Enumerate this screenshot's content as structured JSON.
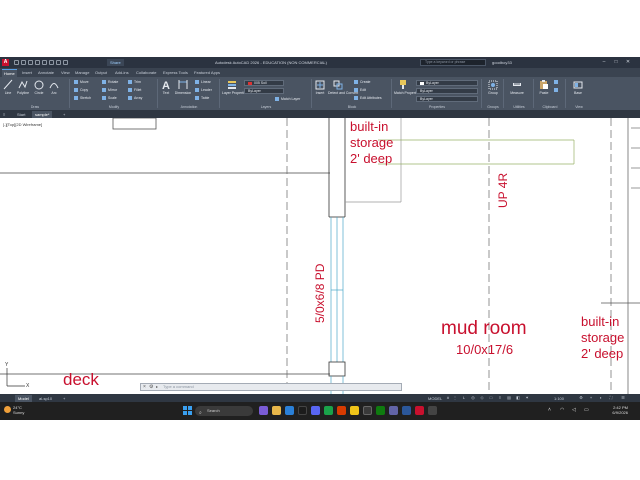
{
  "window": {
    "app_badge": "A",
    "share_label": "Share",
    "title": "Autodesk AutoCAD 2026 - EDUCATION (NON COMMERCIAL)",
    "search_placeholder": "Type a keyword or phrase",
    "user": "goodboy33",
    "min": "–",
    "max": "□",
    "close": "✕"
  },
  "ribbon_tabs": [
    "Home",
    "Insert",
    "Annotate",
    "View",
    "Manage",
    "Output",
    "Add-ins",
    "Collaborate",
    "Express Tools",
    "Featured Apps"
  ],
  "ribbon": {
    "draw": {
      "title": "Draw",
      "tools": [
        "Line",
        "Polyline",
        "Circle",
        "Arc"
      ]
    },
    "modify": {
      "title": "Modify",
      "rows": [
        [
          "Move",
          "Rotate",
          "Trim"
        ],
        [
          "Copy",
          "Mirror",
          "Fillet"
        ],
        [
          "Stretch",
          "Scale",
          "Array"
        ]
      ]
    },
    "annotation": {
      "title": "Annotation",
      "text_label": "Text",
      "dimension_label": "Dimension",
      "side": [
        "Linear",
        "Leader",
        "Table"
      ]
    },
    "layers": {
      "title": "Layers",
      "properties_label": "Layer Properties",
      "combo1": "005 Soil",
      "combo2": "ByLayer",
      "match_label": "Match Layer"
    },
    "block": {
      "title": "Block",
      "insert_label": "Insert",
      "detect_label": "Detect and Convert",
      "side": [
        "Create",
        "Edit",
        "Edit Attributes"
      ]
    },
    "properties": {
      "title": "Properties",
      "match_label": "Match Properties",
      "combos": [
        "ByLayer",
        "ByLayer",
        "ByLayer"
      ]
    },
    "groups": {
      "title": "Groups",
      "label": "Group"
    },
    "utilities": {
      "title": "Utilities",
      "label": "Measure"
    },
    "clipboard": {
      "title": "Clipboard",
      "label": "Paste"
    },
    "view": {
      "title": "View",
      "label": "Base"
    }
  },
  "doc_tabs": [
    "Start",
    "sample*"
  ],
  "canvas": {
    "view_label": "[-][Top][2D Wireframe]",
    "annotations": {
      "storage_top": [
        "built-in",
        "storage",
        "2' deep"
      ],
      "up": "UP 4R",
      "door": "5/0x6/8 PD",
      "room_name": "mud room",
      "room_size": "10/0x17/6",
      "storage_right": [
        "built-in",
        "storage",
        "2' deep"
      ],
      "deck": "deck"
    },
    "annotation_color": "#c8102e",
    "ucs_y": "Y",
    "ucs_x": "X"
  },
  "command_line": {
    "placeholder": "Type a command"
  },
  "status": {
    "layout_tabs": [
      "Model",
      "al-sp10"
    ],
    "model_label": "MODEL",
    "scale": "1:100"
  },
  "taskbar": {
    "weather_temp": "24°C",
    "weather_desc": "Sunny",
    "search_label": "Search",
    "time": "2:42 PM",
    "date": "6/9/2026"
  }
}
